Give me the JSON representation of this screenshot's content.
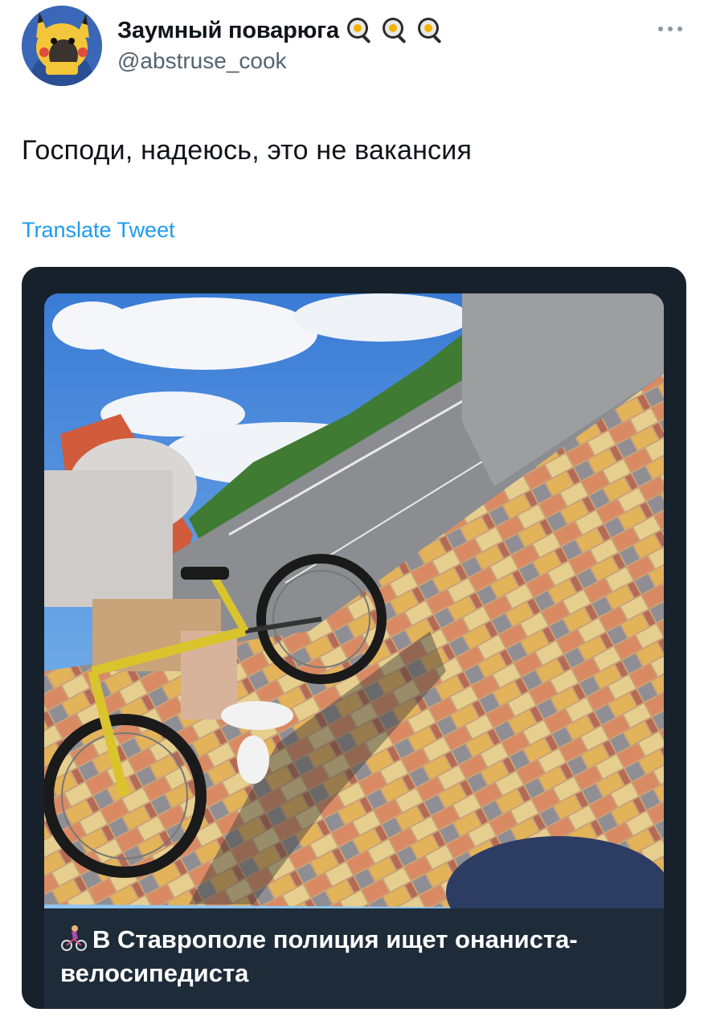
{
  "author": {
    "display_name": "Заумный поварюга",
    "handle": "@abstruse_cook",
    "name_emoji": [
      "frying-pan-egg-emoji",
      "frying-pan-egg-emoji",
      "frying-pan-egg-emoji"
    ]
  },
  "tweet": {
    "text": "Господи, надеюсь, это не вакансия",
    "translate_label": "Translate Tweet"
  },
  "media": {
    "caption": "В Ставрополе полиция ищет онаниста-велосипедиста",
    "caption_emoji": "woman-biking-emoji"
  },
  "colors": {
    "link": "#1d9bf0",
    "secondary_text": "#536471",
    "card_background": "#17212b"
  }
}
